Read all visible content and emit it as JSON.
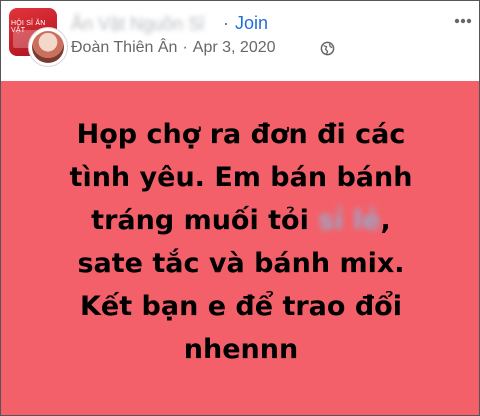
{
  "header": {
    "group_name": "Ăn Vặt Nguồn Sỉ",
    "separator": "·",
    "join_label": "Join",
    "thumbnail_text": "HỘI SỈ ĂN VẶT",
    "author_name": "Đoàn Thiên Ân",
    "date": "Apr 3, 2020",
    "author_separator": "·",
    "more_icon": "ellipsis-horizontal-icon",
    "privacy_icon": "globe-icon"
  },
  "post": {
    "background_color": "#f46069",
    "line1": "Họp chợ ra đơn đi các",
    "line2": "tình yêu. Em bán bánh",
    "line3_start": "tráng muối tỏi",
    "line3_blurred": "sỉ lẻ",
    "line3_end": ",",
    "line4": "sate tắc và bánh mix.",
    "line5": "Kết bạn e để trao đổi",
    "line6": "nhennn"
  }
}
